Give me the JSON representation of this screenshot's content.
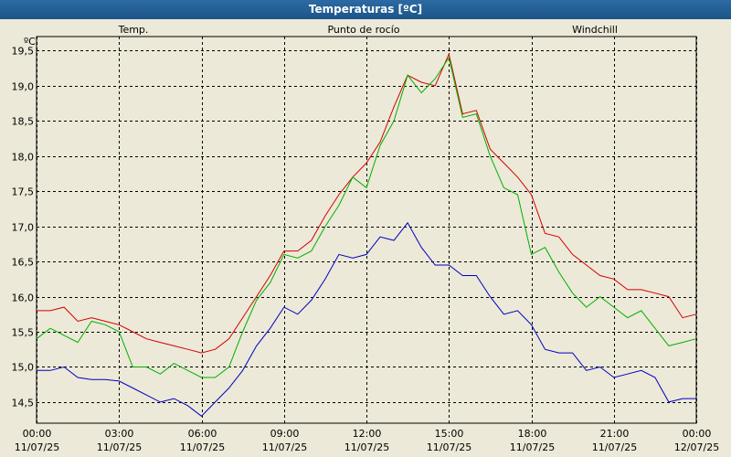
{
  "window": {
    "title": "Temperaturas [ºC]"
  },
  "colors": {
    "temp": "#d40000",
    "dew": "#0000c0",
    "windchill": "#00b000",
    "grid": "#000000",
    "background": "#ece9d8"
  },
  "chart_data": {
    "type": "line",
    "title": "Temperaturas [ºC]",
    "ylabel": "ºC",
    "xlabel": "",
    "ylim": [
      14.2,
      19.7
    ],
    "xlim": [
      0,
      24
    ],
    "grid": true,
    "legend_position": "top",
    "yticks": [
      "14,5",
      "15,0",
      "15,5",
      "16,0",
      "16,5",
      "17,0",
      "17,5",
      "18,0",
      "18,5",
      "19,0",
      "19,5"
    ],
    "ytick_values": [
      14.5,
      15.0,
      15.5,
      16.0,
      16.5,
      17.0,
      17.5,
      18.0,
      18.5,
      19.0,
      19.5
    ],
    "xticks": [
      {
        "time": "00:00",
        "date": "11/07/25"
      },
      {
        "time": "03:00",
        "date": "11/07/25"
      },
      {
        "time": "06:00",
        "date": "11/07/25"
      },
      {
        "time": "09:00",
        "date": "11/07/25"
      },
      {
        "time": "12:00",
        "date": "11/07/25"
      },
      {
        "time": "15:00",
        "date": "11/07/25"
      },
      {
        "time": "18:00",
        "date": "11/07/25"
      },
      {
        "time": "21:00",
        "date": "11/07/25"
      },
      {
        "time": "00:00",
        "date": "12/07/25"
      }
    ],
    "x": [
      0,
      0.5,
      1,
      1.5,
      2,
      2.5,
      3,
      3.5,
      4,
      4.5,
      5,
      5.5,
      6,
      6.5,
      7,
      7.5,
      8,
      8.5,
      9,
      9.5,
      10,
      10.5,
      11,
      11.5,
      12,
      12.5,
      13,
      13.5,
      14,
      14.5,
      15,
      15.5,
      16,
      16.5,
      17,
      17.5,
      18,
      18.5,
      19,
      19.5,
      20,
      20.5,
      21,
      21.5,
      22,
      22.5,
      23,
      23.5,
      24
    ],
    "series": [
      {
        "name": "Temp.",
        "color": "#d40000",
        "values": [
          15.8,
          15.8,
          15.85,
          15.65,
          15.7,
          15.65,
          15.6,
          15.5,
          15.4,
          15.35,
          15.3,
          15.25,
          15.2,
          15.25,
          15.4,
          15.7,
          16.0,
          16.3,
          16.65,
          16.65,
          16.8,
          17.15,
          17.45,
          17.7,
          17.9,
          18.2,
          18.7,
          19.15,
          19.05,
          19.0,
          19.45,
          18.6,
          18.65,
          18.1,
          17.9,
          17.7,
          17.45,
          16.9,
          16.85,
          16.6,
          16.45,
          16.3,
          16.25,
          16.1,
          16.1,
          16.05,
          16.0,
          15.7,
          15.75
        ]
      },
      {
        "name": "Punto de rocío",
        "color": "#0000c0",
        "values": [
          14.95,
          14.95,
          15.0,
          14.85,
          14.82,
          14.82,
          14.8,
          14.7,
          14.6,
          14.5,
          14.55,
          14.45,
          14.3,
          14.5,
          14.7,
          14.95,
          15.3,
          15.55,
          15.85,
          15.75,
          15.95,
          16.25,
          16.6,
          16.55,
          16.6,
          16.85,
          16.8,
          17.05,
          16.7,
          16.45,
          16.45,
          16.3,
          16.3,
          16.0,
          15.75,
          15.8,
          15.6,
          15.25,
          15.2,
          15.2,
          14.95,
          15.0,
          14.85,
          14.9,
          14.95,
          14.85,
          14.5,
          14.55,
          14.55
        ]
      },
      {
        "name": "Windchill",
        "color": "#00b000",
        "values": [
          15.4,
          15.55,
          15.45,
          15.35,
          15.65,
          15.6,
          15.5,
          15.0,
          15.0,
          14.9,
          15.05,
          14.95,
          14.85,
          14.85,
          15.0,
          15.5,
          15.95,
          16.2,
          16.6,
          16.55,
          16.65,
          17.0,
          17.3,
          17.7,
          17.55,
          18.15,
          18.5,
          19.15,
          18.9,
          19.1,
          19.4,
          18.55,
          18.6,
          18.0,
          17.55,
          17.45,
          16.6,
          16.7,
          16.35,
          16.05,
          15.85,
          16.0,
          15.85,
          15.7,
          15.8,
          15.55,
          15.3,
          15.35,
          15.4
        ]
      }
    ]
  }
}
